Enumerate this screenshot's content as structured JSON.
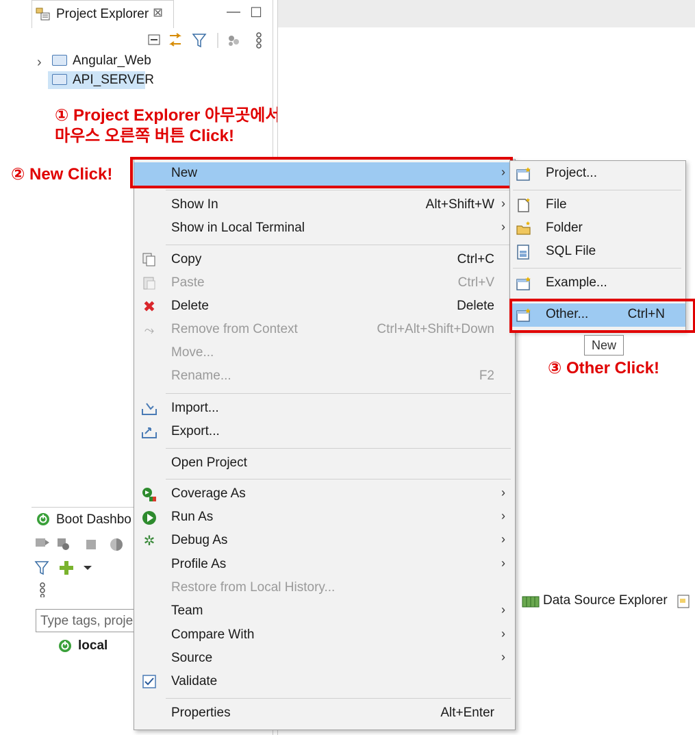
{
  "explorer": {
    "tab_title": "Project Explorer",
    "close_glyph": "⊠",
    "minimize_glyph": "—",
    "maximize_glyph": "☐",
    "projects": [
      {
        "name": "Angular_Web",
        "expand": "›"
      },
      {
        "name": "API_SERVER",
        "selected": true
      }
    ]
  },
  "annotations": {
    "step1_line1": "① Project Explorer 아무곳에서",
    "step1_line2": "마우스 오른쪽 버튼 Click!",
    "step2": "② New Click!",
    "step3": "③ Other Click!"
  },
  "boot_dashboard": {
    "title": "Boot Dashbo",
    "filter_placeholder": "Type tags, proje",
    "local_label": "local"
  },
  "context_menu": {
    "items": [
      {
        "label": "New",
        "shortcut": "",
        "submenu": true,
        "highlighted": true
      },
      {
        "label": "Show In",
        "shortcut": "Alt+Shift+W",
        "submenu": true
      },
      {
        "label": "Show in Local Terminal",
        "shortcut": "",
        "submenu": true
      },
      {
        "label": "Copy",
        "shortcut": "Ctrl+C",
        "icon": "copy-icon"
      },
      {
        "label": "Paste",
        "shortcut": "Ctrl+V",
        "icon": "paste-icon",
        "disabled": true
      },
      {
        "label": "Delete",
        "shortcut": "Delete",
        "icon": "delete-icon"
      },
      {
        "label": "Remove from Context",
        "shortcut": "Ctrl+Alt+Shift+Down",
        "icon": "remove-context-icon",
        "disabled": true
      },
      {
        "label": "Move...",
        "shortcut": "",
        "disabled": true
      },
      {
        "label": "Rename...",
        "shortcut": "F2",
        "disabled": true
      },
      {
        "label": "Import...",
        "shortcut": "",
        "icon": "import-icon"
      },
      {
        "label": "Export...",
        "shortcut": "",
        "icon": "export-icon"
      },
      {
        "label": "Open Project",
        "shortcut": ""
      },
      {
        "label": "Coverage As",
        "shortcut": "",
        "icon": "coverage-icon",
        "submenu": true
      },
      {
        "label": "Run As",
        "shortcut": "",
        "icon": "run-icon",
        "submenu": true
      },
      {
        "label": "Debug As",
        "shortcut": "",
        "icon": "debug-icon",
        "submenu": true
      },
      {
        "label": "Profile As",
        "shortcut": "",
        "submenu": true
      },
      {
        "label": "Restore from Local History...",
        "shortcut": "",
        "disabled": true
      },
      {
        "label": "Team",
        "shortcut": "",
        "submenu": true
      },
      {
        "label": "Compare With",
        "shortcut": "",
        "submenu": true
      },
      {
        "label": "Source",
        "shortcut": "",
        "submenu": true
      },
      {
        "label": "Validate",
        "shortcut": "",
        "icon": "checkbox-checked-icon"
      },
      {
        "label": "Properties",
        "shortcut": "Alt+Enter"
      }
    ],
    "arrow_glyph": "›"
  },
  "new_submenu": {
    "items": [
      {
        "label": "Project...",
        "shortcut": "",
        "icon": "new-project-icon"
      },
      {
        "label": "File",
        "shortcut": "",
        "icon": "new-file-icon"
      },
      {
        "label": "Folder",
        "shortcut": "",
        "icon": "new-folder-icon"
      },
      {
        "label": "SQL File",
        "shortcut": "",
        "icon": "sql-file-icon"
      },
      {
        "label": "Example...",
        "shortcut": "",
        "icon": "example-icon"
      },
      {
        "label": "Other...",
        "shortcut": "Ctrl+N",
        "icon": "other-icon",
        "highlighted": true
      }
    ],
    "tooltip": "New"
  },
  "right_panel": {
    "data_source_tab": "Data Source Explorer"
  },
  "colors": {
    "annotation_red": "#e00000",
    "menu_highlight": "#9dcaf2",
    "menu_bg": "#f2f2f2"
  }
}
